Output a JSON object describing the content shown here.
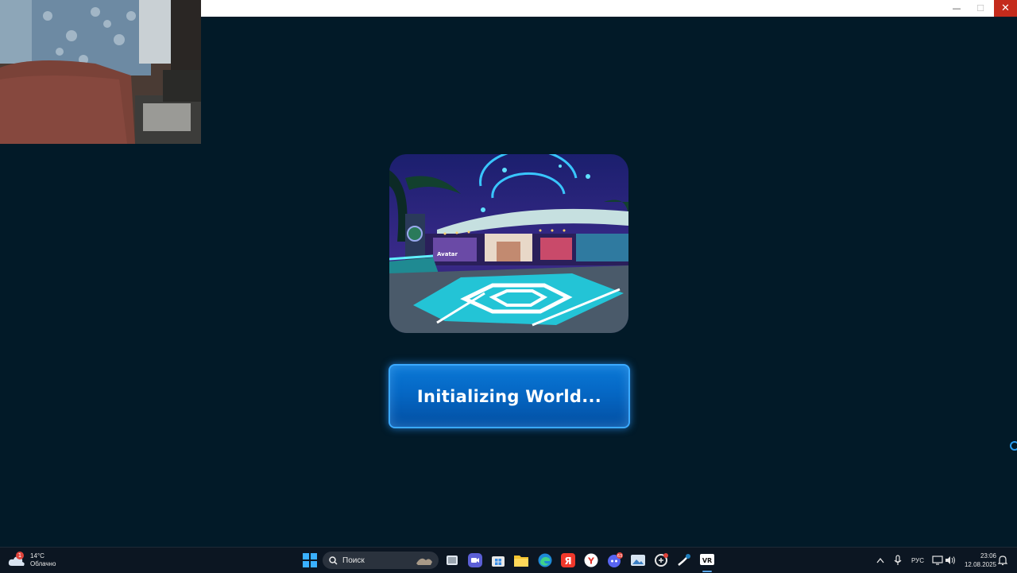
{
  "window": {
    "minimize_glyph": "—",
    "maximize_glyph": "☐",
    "close_glyph": "✕"
  },
  "loading": {
    "status_text": "Initializing World..."
  },
  "taskbar": {
    "weather": {
      "temperature": "14°C",
      "condition": "Облачно",
      "badge": "1"
    },
    "search": {
      "placeholder": "Поиск"
    },
    "apps": [
      {
        "name": "start-icon"
      },
      {
        "name": "task-view-icon"
      },
      {
        "name": "zoom-icon"
      },
      {
        "name": "microsoft-store-icon"
      },
      {
        "name": "file-explorer-icon"
      },
      {
        "name": "edge-icon"
      },
      {
        "name": "yandex-icon"
      },
      {
        "name": "yandex-browser-icon"
      },
      {
        "name": "discord-icon",
        "badge": "63"
      },
      {
        "name": "photos-icon"
      },
      {
        "name": "game-app-icon"
      },
      {
        "name": "steam-icon"
      },
      {
        "name": "vrchat-icon",
        "label": "VR"
      }
    ],
    "tray": {
      "language": "РУС",
      "time": "23:06",
      "date": "12.08.2025"
    }
  },
  "colors": {
    "background": "#021a28",
    "button": "#0567c4",
    "button_glow": "#3aa9ff",
    "close_button": "#c42b1c"
  }
}
